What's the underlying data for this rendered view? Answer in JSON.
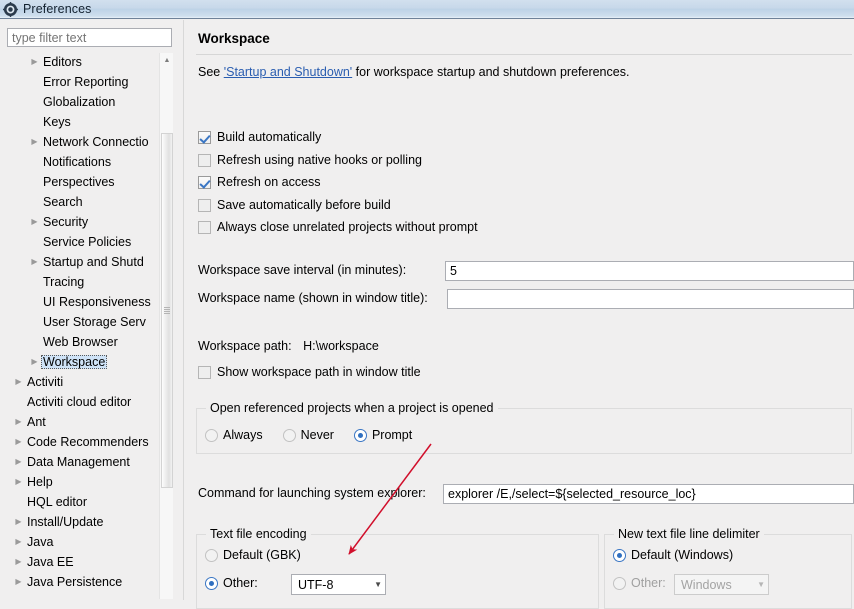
{
  "window": {
    "title": "Preferences",
    "icon": "preferences-gear-icon"
  },
  "sidebar": {
    "filter": {
      "placeholder": "type filter text",
      "value": ""
    },
    "items": [
      {
        "label": "Editors",
        "indent": 1,
        "arrow": true,
        "selected": false
      },
      {
        "label": "Error Reporting",
        "indent": 1,
        "arrow": false,
        "selected": false
      },
      {
        "label": "Globalization",
        "indent": 1,
        "arrow": false,
        "selected": false
      },
      {
        "label": "Keys",
        "indent": 1,
        "arrow": false,
        "selected": false
      },
      {
        "label": "Network Connectio",
        "indent": 1,
        "arrow": true,
        "selected": false
      },
      {
        "label": "Notifications",
        "indent": 1,
        "arrow": false,
        "selected": false
      },
      {
        "label": "Perspectives",
        "indent": 1,
        "arrow": false,
        "selected": false
      },
      {
        "label": "Search",
        "indent": 1,
        "arrow": false,
        "selected": false
      },
      {
        "label": "Security",
        "indent": 1,
        "arrow": true,
        "selected": false
      },
      {
        "label": "Service Policies",
        "indent": 1,
        "arrow": false,
        "selected": false
      },
      {
        "label": "Startup and Shutd",
        "indent": 1,
        "arrow": true,
        "selected": false
      },
      {
        "label": "Tracing",
        "indent": 1,
        "arrow": false,
        "selected": false
      },
      {
        "label": "UI Responsiveness",
        "indent": 1,
        "arrow": false,
        "selected": false
      },
      {
        "label": "User Storage Serv",
        "indent": 1,
        "arrow": false,
        "selected": false
      },
      {
        "label": "Web Browser",
        "indent": 1,
        "arrow": false,
        "selected": false
      },
      {
        "label": "Workspace",
        "indent": 1,
        "arrow": true,
        "selected": true
      },
      {
        "label": "Activiti",
        "indent": 0,
        "arrow": true,
        "selected": false
      },
      {
        "label": "Activiti cloud editor",
        "indent": 0,
        "arrow": false,
        "selected": false
      },
      {
        "label": "Ant",
        "indent": 0,
        "arrow": true,
        "selected": false
      },
      {
        "label": "Code Recommenders",
        "indent": 0,
        "arrow": true,
        "selected": false
      },
      {
        "label": "Data Management",
        "indent": 0,
        "arrow": true,
        "selected": false
      },
      {
        "label": "Help",
        "indent": 0,
        "arrow": true,
        "selected": false
      },
      {
        "label": "HQL editor",
        "indent": 0,
        "arrow": false,
        "selected": false
      },
      {
        "label": "Install/Update",
        "indent": 0,
        "arrow": true,
        "selected": false
      },
      {
        "label": "Java",
        "indent": 0,
        "arrow": true,
        "selected": false
      },
      {
        "label": "Java EE",
        "indent": 0,
        "arrow": true,
        "selected": false
      },
      {
        "label": "Java Persistence",
        "indent": 0,
        "arrow": true,
        "selected": false
      }
    ],
    "scroll_up_icon": "chevron-up-icon"
  },
  "main": {
    "title": "Workspace",
    "see_prefix": "See ",
    "see_link": "'Startup and Shutdown'",
    "see_suffix": " for workspace startup and shutdown preferences.",
    "checkboxes": [
      {
        "label": "Build automatically",
        "checked": true
      },
      {
        "label": "Refresh using native hooks or polling",
        "checked": false
      },
      {
        "label": "Refresh on access",
        "checked": true
      },
      {
        "label": "Save automatically before build",
        "checked": false
      },
      {
        "label": "Always close unrelated projects without prompt",
        "checked": false
      }
    ],
    "save_interval": {
      "label": "Workspace save interval (in minutes):",
      "value": "5"
    },
    "workspace_name": {
      "label": "Workspace name (shown in window title):",
      "value": ""
    },
    "workspace_path": {
      "label": "Workspace path:",
      "value": "H:\\workspace"
    },
    "show_path_checkbox": {
      "label": "Show workspace path in window title",
      "checked": false
    },
    "referenced_group": {
      "title": "Open referenced projects when a project is opened",
      "options": [
        {
          "label": "Always",
          "selected": false
        },
        {
          "label": "Never",
          "selected": false
        },
        {
          "label": "Prompt",
          "selected": true
        }
      ]
    },
    "command": {
      "label": "Command for launching system explorer:",
      "value": "explorer /E,/select=${selected_resource_loc}"
    },
    "text_encoding_group": {
      "title": "Text file encoding",
      "default_option": {
        "label": "Default (GBK)",
        "selected": false
      },
      "other_option": {
        "label": "Other:",
        "selected": true
      },
      "combo_value": "UTF-8",
      "combo_caret": "chevron-down-icon"
    },
    "line_delimiter_group": {
      "title": "New text file line delimiter",
      "default_option": {
        "label": "Default (Windows)",
        "selected": true
      },
      "other_option": {
        "label": "Other:",
        "selected": false
      },
      "combo_value": "Windows",
      "combo_caret": "chevron-down-icon"
    }
  },
  "annotation": {
    "color": "#d10f2b",
    "shape": "arrow"
  }
}
